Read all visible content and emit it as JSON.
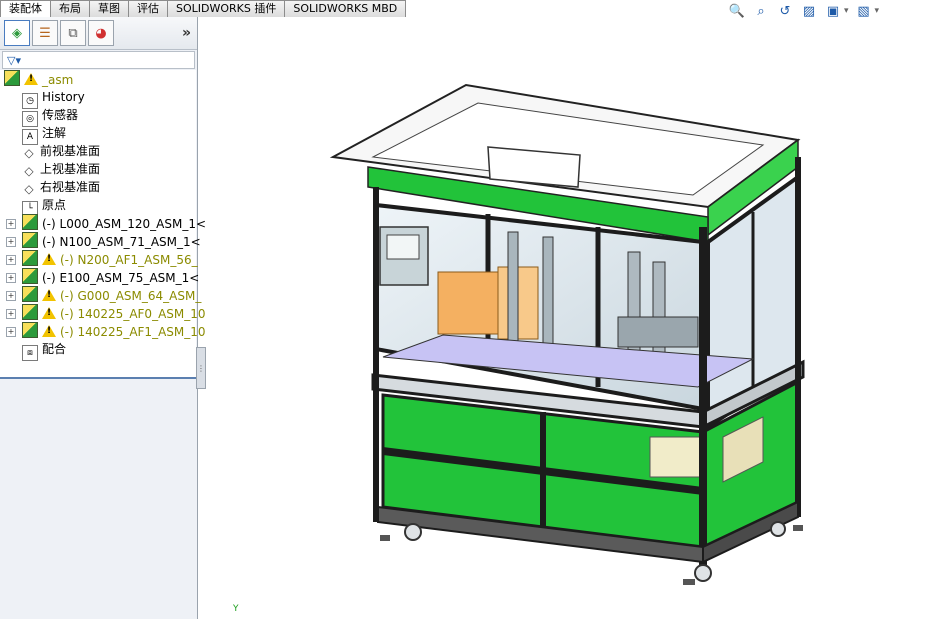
{
  "command_manager": {
    "tabs": [
      {
        "label": "装配体",
        "active": true
      },
      {
        "label": "布局",
        "active": false
      },
      {
        "label": "草图",
        "active": false
      },
      {
        "label": "评估",
        "active": false
      },
      {
        "label": "SOLIDWORKS 插件",
        "active": false
      },
      {
        "label": "SOLIDWORKS MBD",
        "active": false
      }
    ]
  },
  "view_toolbar": {
    "icons": [
      "zoom-to-fit-icon",
      "zoom-to-area-icon",
      "previous-view-icon",
      "section-view-icon",
      "view-orientation-icon",
      "display-style-icon"
    ]
  },
  "feature_manager": {
    "panel_tabs": [
      "feature-manager-tab-icon",
      "property-manager-tab-icon",
      "configuration-manager-tab-icon",
      "appearance-tab-icon"
    ],
    "expand_glyph": "»",
    "root": {
      "label": "_asm",
      "warning": true
    },
    "items": [
      {
        "label": "History",
        "icon": "history-icon",
        "color": "#000000"
      },
      {
        "label": "传感器",
        "icon": "sensor-icon",
        "color": "#000000"
      },
      {
        "label": "注解",
        "icon": "annotation-icon",
        "color": "#000000"
      },
      {
        "label": "前视基准面",
        "icon": "plane-icon",
        "color": "#000000"
      },
      {
        "label": "上视基准面",
        "icon": "plane-icon",
        "color": "#000000"
      },
      {
        "label": "右视基准面",
        "icon": "plane-icon",
        "color": "#000000"
      },
      {
        "label": "原点",
        "icon": "origin-icon",
        "color": "#000000"
      },
      {
        "label": "(-) L000_ASM_120_ASM_1<",
        "icon": "subassembly-icon",
        "warning": false,
        "color": "#000000"
      },
      {
        "label": "(-) N100_ASM_71_ASM_1<",
        "icon": "subassembly-icon",
        "warning": false,
        "color": "#000000"
      },
      {
        "label": "(-) N200_AF1_ASM_56_",
        "icon": "subassembly-icon",
        "warning": true,
        "color": "#8b8b00"
      },
      {
        "label": "(-) E100_ASM_75_ASM_1<",
        "icon": "subassembly-icon",
        "warning": false,
        "color": "#000000"
      },
      {
        "label": "(-) G000_ASM_64_ASM_",
        "icon": "subassembly-icon",
        "warning": true,
        "color": "#8b8b00"
      },
      {
        "label": "(-) 140225_AF0_ASM_10",
        "icon": "subassembly-icon",
        "warning": true,
        "color": "#8b8b00"
      },
      {
        "label": "(-) 140225_AF1_ASM_10",
        "icon": "subassembly-icon",
        "warning": true,
        "color": "#8b8b00"
      },
      {
        "label": "配合",
        "icon": "mates-icon",
        "color": "#000000"
      }
    ]
  },
  "triad": {
    "axis_label": "Y"
  },
  "colors": {
    "frame": "#1c1c1c",
    "panel_green": "#22c33a",
    "glass": "#d8e4ec",
    "part_orange": "#f4b061",
    "part_cream": "#f1ecc9"
  }
}
